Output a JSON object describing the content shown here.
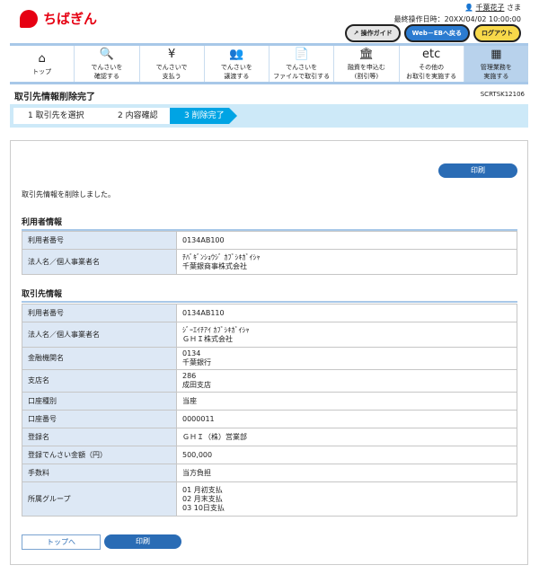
{
  "header": {
    "logo": "ちばぎん",
    "user_name": "千葉花子",
    "user_suffix": "さま",
    "last_login": "最終操作日時：20XX/04/02 10:00:00",
    "guide": "操作ガイド",
    "web_eb": "Web－EBへ戻る",
    "logout": "ログアウト"
  },
  "nav": [
    {
      "icon": "⌂",
      "label": "トップ"
    },
    {
      "icon": "🔍",
      "label": "でんさいを\n確認する"
    },
    {
      "icon": "¥",
      "label": "でんさいで\n支払う"
    },
    {
      "icon": "👥",
      "label": "でんさいを\n譲渡する"
    },
    {
      "icon": "📄",
      "label": "でんさいを\nファイルで取引する"
    },
    {
      "icon": "🏛",
      "label": "融資を申込む\n(割引等)"
    },
    {
      "icon": "etc",
      "label": "その他の\nお取引を実施する"
    },
    {
      "icon": "▦",
      "label": "管理業務を\n実施する"
    }
  ],
  "page": {
    "title": "取引先情報削除完了",
    "screen_id": "SCRTSK12106"
  },
  "steps": [
    "1 取引先を選択",
    "2 内容確認",
    "3 削除完了"
  ],
  "print": "印刷",
  "message": "取引先情報を削除しました。",
  "user_info": {
    "heading": "利用者情報",
    "rows": [
      [
        "利用者番号",
        "0134AB100"
      ],
      [
        "法人名／個人事業者名",
        "ﾁﾊﾞｷﾞﾝｼｮｳｼﾞ ｶﾌﾞｼｷｶﾞｲｼｬ\n千葉銀商事株式会社"
      ]
    ]
  },
  "partner_info": {
    "heading": "取引先情報",
    "rows": [
      [
        "利用者番号",
        "0134AB110"
      ],
      [
        "法人名／個人事業者名",
        "ｼﾞｰｴｲﾁｱｲ ｶﾌﾞｼｷｶﾞｲｼｬ\nＧＨＩ株式会社"
      ],
      [
        "金融機関名",
        "0134\n千葉銀行"
      ],
      [
        "支店名",
        "286\n成田支店"
      ],
      [
        "口座種別",
        "当座"
      ],
      [
        "口座番号",
        "0000011"
      ],
      [
        "登録名",
        "ＧＨＩ（株）営業部"
      ],
      [
        "登録でんさい金額（円）",
        "500,000"
      ],
      [
        "手数料",
        "当方負担"
      ],
      [
        "所属グループ",
        "01 月初支払\n02 月末支払\n03 10日支払"
      ]
    ]
  },
  "footer": {
    "top": "トップへ",
    "print": "印刷"
  }
}
